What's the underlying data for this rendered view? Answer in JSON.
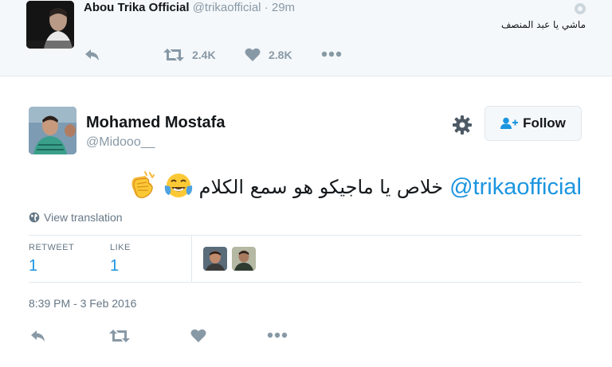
{
  "parent_tweet": {
    "name": "Abou Trika Official",
    "handle": "@trikaofficial",
    "separator": "·",
    "time": "29m",
    "text": "ماشي يا عبد المنصف",
    "retweets": "2.4K",
    "likes": "2.8K"
  },
  "tweet": {
    "name": "Mohamed Mostafa",
    "handle": "@Midooo__",
    "follow_label": "Follow",
    "mention": "@trikaofficial",
    "text": "خلاص يا ماجيكو هو سمع الكلام",
    "view_translation": "View translation",
    "retweet_label": "RETWEET",
    "retweet_count": "1",
    "like_label": "LIKE",
    "like_count": "1",
    "timestamp": "8:39 PM - 3 Feb 2016"
  },
  "colors": {
    "link_blue": "#1b95e0",
    "muted_gray": "#8899a6",
    "border": "#e1e8ed",
    "parent_bg": "#f5f8fa"
  },
  "icons": [
    "reply-icon",
    "retweet-icon",
    "heart-icon",
    "more-icon",
    "gear-icon",
    "follow-user-icon",
    "globe-icon",
    "clapping-hands-emoji",
    "tears-of-joy-emoji"
  ]
}
